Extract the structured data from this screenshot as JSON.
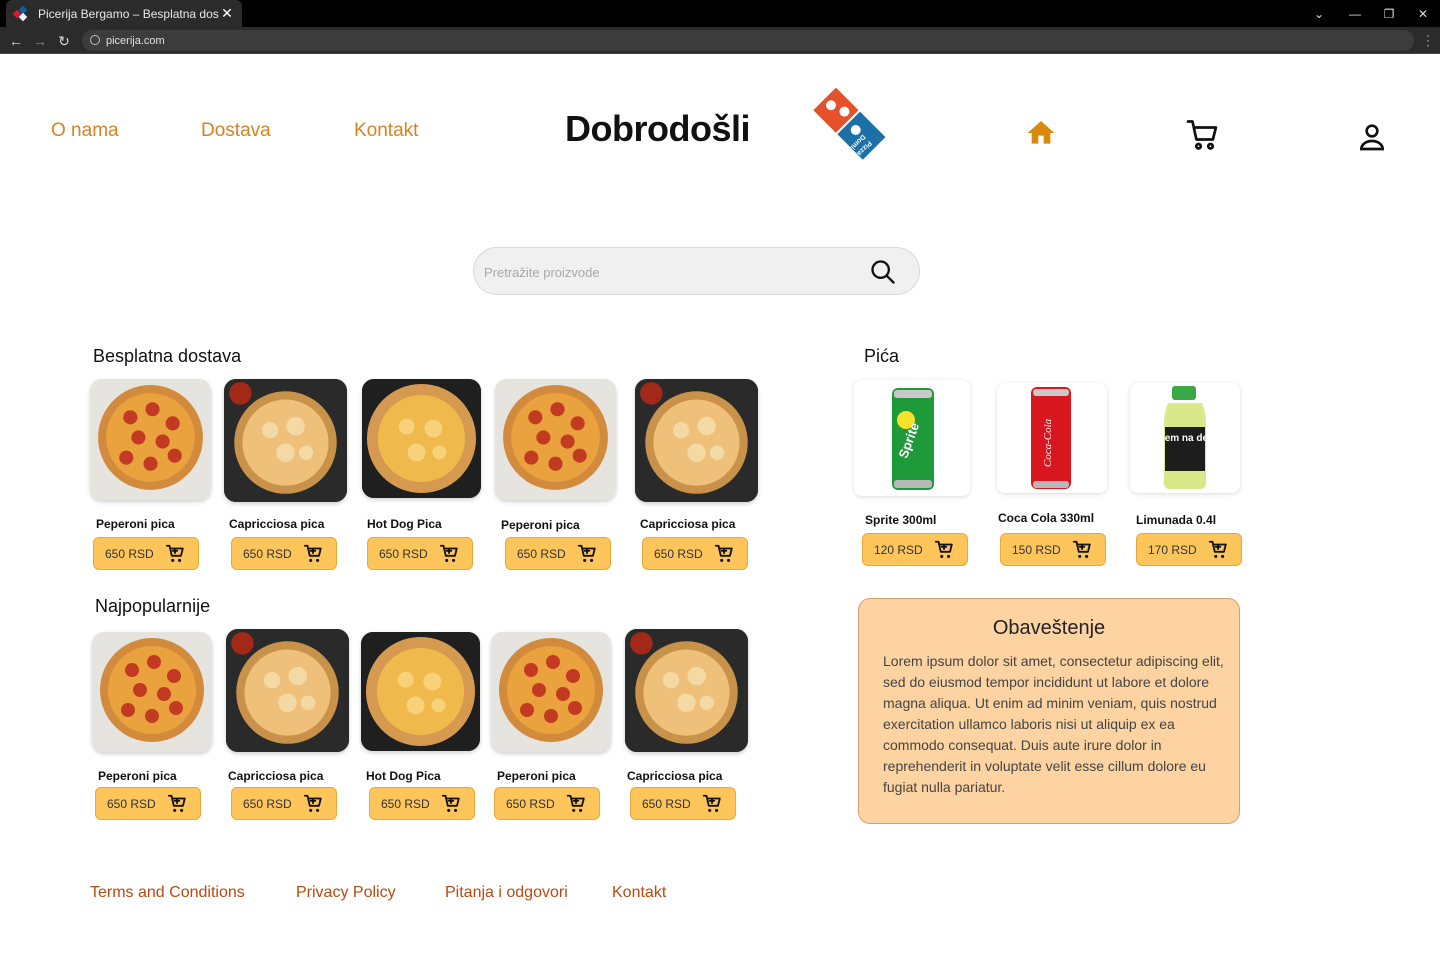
{
  "browser": {
    "tab_title": "Picerija Bergamo – Besplatna dos",
    "url": "picerija.com"
  },
  "header": {
    "nav": [
      "O nama",
      "Dostava",
      "Kontakt"
    ],
    "brand": "Dobrodošli",
    "logo_text": "Domino's Pizza",
    "icons": [
      "home-icon",
      "cart-icon",
      "user-icon"
    ],
    "accent_color": "#d9821f"
  },
  "search": {
    "placeholder": "Pretražite proizvode"
  },
  "sections": {
    "free_delivery": {
      "title": "Besplatna dostava",
      "items": [
        {
          "name": "Peperoni pica",
          "price": "650 RSD"
        },
        {
          "name": "Capricciosa pica",
          "price": "650 RSD"
        },
        {
          "name": "Hot Dog Pica",
          "price": "650 RSD"
        },
        {
          "name": "Peperoni pica",
          "price": "650 RSD"
        },
        {
          "name": "Capricciosa pica",
          "price": "650 RSD"
        }
      ]
    },
    "popular": {
      "title": "Najpopularnije",
      "items": [
        {
          "name": "Peperoni pica",
          "price": "650 RSD"
        },
        {
          "name": "Capricciosa pica",
          "price": "650 RSD"
        },
        {
          "name": "Hot Dog Pica",
          "price": "650 RSD"
        },
        {
          "name": "Peperoni pica",
          "price": "650 RSD"
        },
        {
          "name": "Capricciosa pica",
          "price": "650 RSD"
        }
      ]
    },
    "drinks": {
      "title": "Pića",
      "items": [
        {
          "name": "Sprite 300ml",
          "price": "120 RSD",
          "label": "Sprite"
        },
        {
          "name": "Coca Cola 330ml",
          "price": "150 RSD",
          "label": "Coca-Cola"
        },
        {
          "name": "Limunada 0.4l",
          "price": "170 RSD",
          "label": "lem na de"
        }
      ]
    }
  },
  "notice": {
    "title": "Obaveštenje",
    "body": "Lorem ipsum dolor sit amet, consectetur adipiscing elit, sed do eiusmod tempor incididunt ut labore et dolore magna aliqua. Ut enim ad minim veniam, quis nostrud exercitation ullamco laboris nisi ut aliquip ex ea commodo consequat. Duis aute irure dolor in reprehenderit in voluptate velit esse cillum dolore eu fugiat nulla pariatur."
  },
  "footer": {
    "links": [
      "Terms and Conditions",
      "Privacy Policy",
      "Pitanja i odgovori",
      "Kontakt"
    ]
  },
  "colors": {
    "button_bg": "#fdc55a",
    "notice_bg": "#fdd3a2",
    "footer_link": "#b84a10"
  }
}
